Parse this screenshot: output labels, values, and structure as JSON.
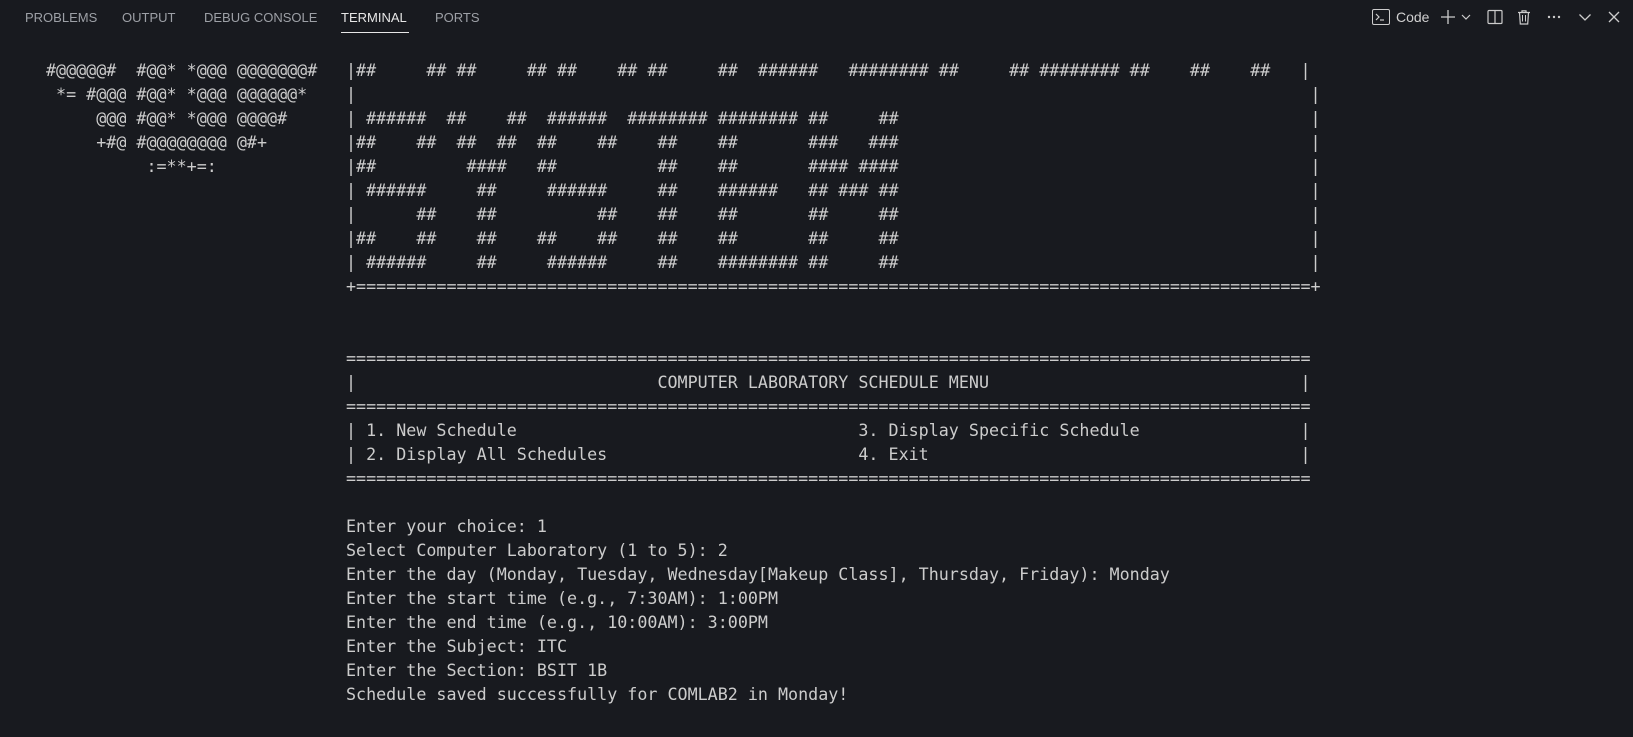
{
  "panel": {
    "tabs": [
      "PROBLEMS",
      "OUTPUT",
      "DEBUG CONSOLE",
      "TERMINAL",
      "PORTS"
    ],
    "active_tab": "TERMINAL",
    "terminal_name": "Code",
    "icons": [
      "terminal-icon",
      "plus-icon",
      "chevron-down-icon",
      "split-icon",
      "trash-icon",
      "more-icon",
      "collapse-icon",
      "close-icon"
    ]
  },
  "terminal": {
    "logo": [
      "#@@@@@#  #@@* *@@@ @@@@@@@#",
      " *= #@@@ #@@* *@@@ @@@@@@*",
      "     @@@ #@@* *@@@ @@@@#",
      "     +#@ #@@@@@@@@ @#+",
      "          :=**+=:"
    ],
    "banner": [
      "|##     ## ##     ## ##    ## ##     ##  ######   ######## ##     ## ######## ##    ##    ##   |",
      "|                                                                                               |",
      "| ######  ##    ##  ######  ######## ######## ##     ##                                         |",
      "|##    ##  ##  ##  ##    ##    ##    ##       ###   ###                                         |",
      "|##         ####   ##          ##    ##       #### ####                                         |",
      "| ######     ##     ######     ##    ######   ## ### ##                                         |",
      "|      ##    ##          ##    ##    ##       ##     ##                                         |",
      "|##    ##    ##    ##    ##    ##    ##       ##     ##                                         |",
      "| ######     ##     ######     ##    ######## ##     ##                                         |",
      "+===============================================================================================+"
    ],
    "menu": [
      "================================================================================================",
      "|                              COMPUTER LABORATORY SCHEDULE MENU                               |",
      "================================================================================================",
      "| 1. New Schedule                                  3. Display Specific Schedule                |",
      "| 2. Display All Schedules                         4. Exit                                     |",
      "================================================================================================"
    ],
    "session": [
      "Enter your choice: 1",
      "Select Computer Laboratory (1 to 5): 2",
      "Enter the day (Monday, Tuesday, Wednesday[Makeup Class], Thursday, Friday): Monday",
      "Enter the start time (e.g., 7:30AM): 1:00PM",
      "Enter the end time (e.g., 10:00AM): 3:00PM",
      "Enter the Subject: ITC",
      "Enter the Section: BSIT 1B",
      "Schedule saved successfully for COMLAB2 in Monday!"
    ]
  }
}
